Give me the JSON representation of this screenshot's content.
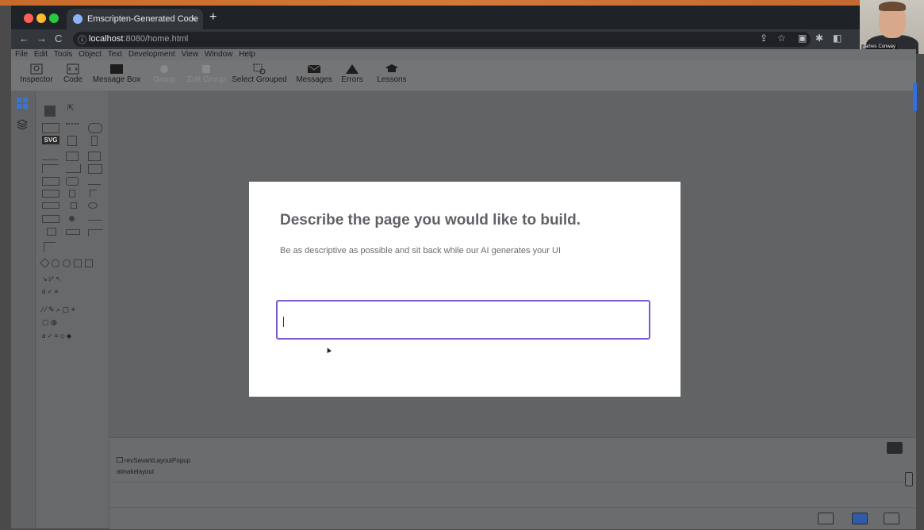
{
  "browser": {
    "tab_title": "Emscripten-Generated Code",
    "tab_close": "×",
    "new_tab": "+",
    "url_host": "localhost",
    "url_rest": ":8080/home.html",
    "back": "←",
    "forward": "→",
    "reload": "C"
  },
  "webcam": {
    "name": "James Conway"
  },
  "app": {
    "menu": [
      "File",
      "Edit",
      "Tools",
      "Object",
      "Text",
      "Development",
      "View",
      "Window",
      "Help"
    ],
    "toolbar": {
      "inspector": "Inspector",
      "code": "Code",
      "message_box": "Message Box",
      "group": "Group",
      "edit_group": "Edit Group",
      "select_grouped": "Select Grouped",
      "messages": "Messages",
      "errors": "Errors",
      "lessons": "Lessons"
    },
    "palette": {
      "svg_label": "SVG"
    },
    "bottom_panel": {
      "row1": "revSavantLayoutPopup",
      "row2": "aimakelayout"
    }
  },
  "modal": {
    "title": "Describe the page you would like to build.",
    "subtitle": "Be as descriptive as possible and sit back while our AI generates your UI",
    "input_value": "",
    "input_placeholder": ""
  },
  "colors": {
    "accent": "#7b5bd0",
    "chrome_bg": "#1f2226",
    "link_blue": "#2f6fea"
  }
}
